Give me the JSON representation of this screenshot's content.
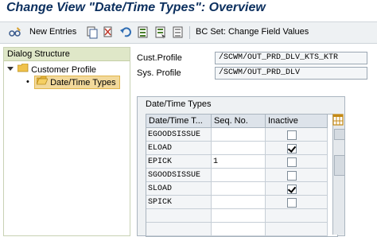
{
  "title": "Change View \"Date/Time Types\": Overview",
  "toolbar": {
    "new_entries": "New Entries",
    "bc_set": "BC Set: Change Field Values"
  },
  "dialog_structure": {
    "header": "Dialog Structure",
    "items": [
      {
        "label": "Customer Profile",
        "level": 0
      },
      {
        "label": "Date/Time Types",
        "level": 1,
        "selected": true
      }
    ]
  },
  "profiles": {
    "cust_label": "Cust.Profile",
    "cust_value": "/SCWM/OUT_PRD_DLV_KTS_KTR",
    "sys_label": "Sys. Profile",
    "sys_value": "/SCWM/OUT_PRD_DLV"
  },
  "table": {
    "title": "Date/Time Types",
    "columns": [
      "Date/Time T...",
      "Seq. No.",
      "Inactive"
    ],
    "rows": [
      {
        "type": "EGOODSISSUE",
        "seq": "",
        "inactive": false
      },
      {
        "type": "ELOAD",
        "seq": "",
        "inactive": true
      },
      {
        "type": "EPICK",
        "seq": "1",
        "inactive": false
      },
      {
        "type": "SGOODSISSUE",
        "seq": "",
        "inactive": false
      },
      {
        "type": "SLOAD",
        "seq": "",
        "inactive": true
      },
      {
        "type": "SPICK",
        "seq": "",
        "inactive": false
      }
    ]
  }
}
